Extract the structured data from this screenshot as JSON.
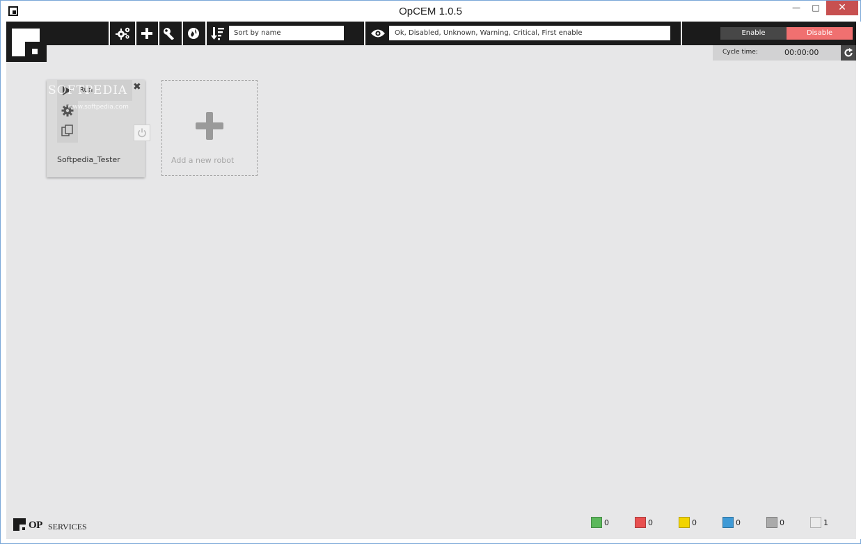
{
  "window": {
    "title": "OpCEM 1.0.5",
    "minimize_glyph": "—",
    "maximize_glyph": "□",
    "close_glyph": "✕"
  },
  "toolbar": {
    "icons": [
      "settings-gears-icon",
      "add-icon",
      "key-icon",
      "globe-icon",
      "sort-icon"
    ],
    "sort_value": "Sort by name",
    "filter_icon": "eye-icon",
    "filter_value": "Ok, Disabled, Unknown, Warning, Critical, First enable",
    "enable_label": "Enable",
    "disable_label": "Disable",
    "enable_color": "#474747",
    "disable_color": "#f07070"
  },
  "cycle": {
    "label": "Cycle time:",
    "value": "00:00:00",
    "refresh_icon": "refresh-icon"
  },
  "robot_card": {
    "run_label": "Run",
    "close_glyph": "✖",
    "name": "Softpedia_Tester",
    "watermark": "SOFTPEDIA",
    "watermark_url": "www.softpedia.com"
  },
  "add_robot": {
    "label": "Add a new robot"
  },
  "footer": {
    "brand_op": "OP",
    "brand_services": "SERVICES",
    "status": [
      {
        "color": "#5cb85c",
        "count": "0"
      },
      {
        "color": "#e85050",
        "count": "0"
      },
      {
        "color": "#f2d400",
        "count": "0"
      },
      {
        "color": "#3f9ad6",
        "count": "0"
      },
      {
        "color": "#aaaaaa",
        "count": "0"
      },
      {
        "color": "#ebebeb",
        "count": "1"
      }
    ]
  }
}
